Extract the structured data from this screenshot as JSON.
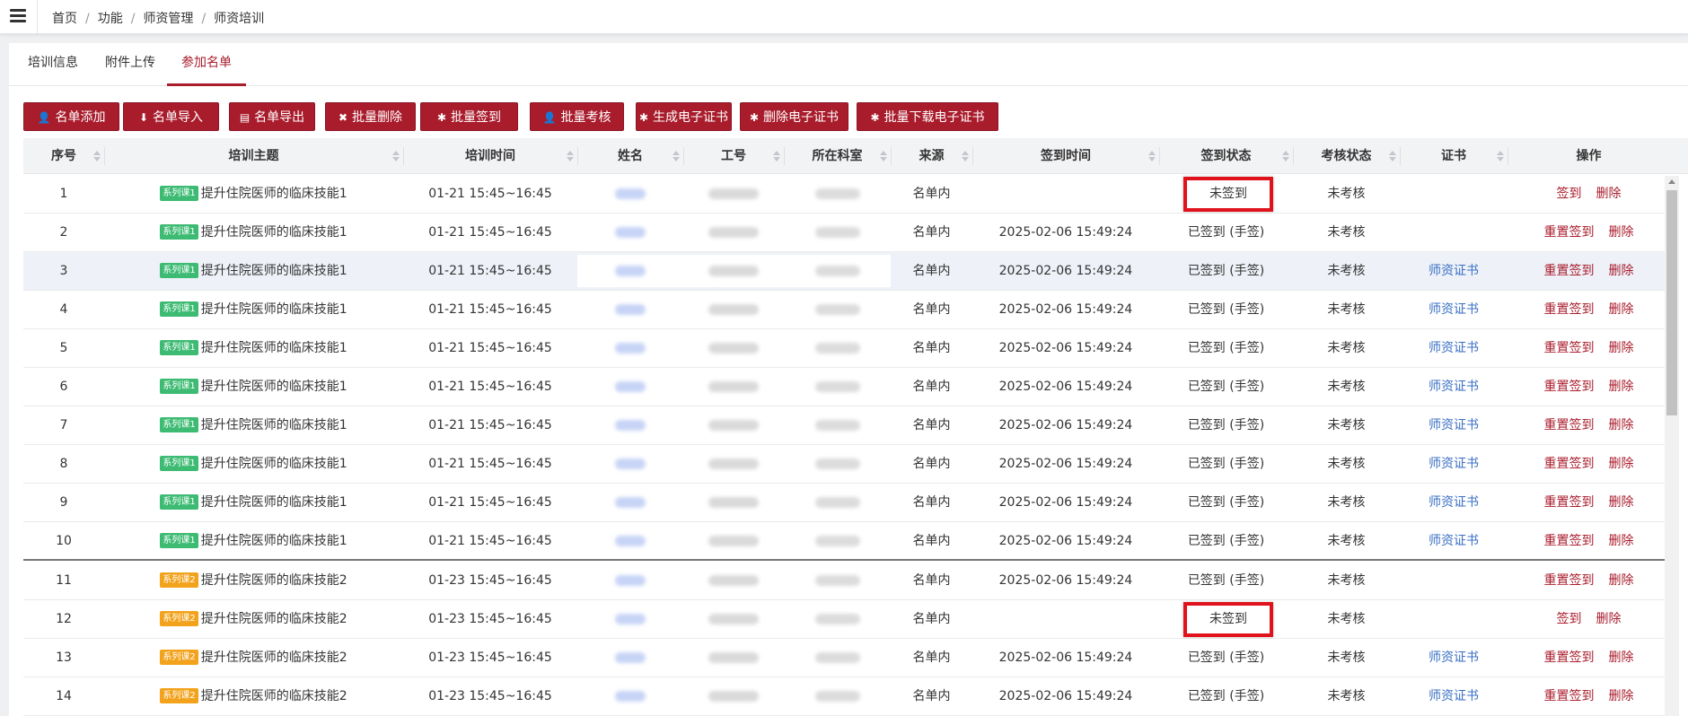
{
  "breadcrumb": [
    "首页",
    "功能",
    "师资管理",
    "师资培训"
  ],
  "tabs": [
    "培训信息",
    "附件上传",
    "参加名单"
  ],
  "active_tab": 2,
  "toolbar": [
    {
      "label": "名单添加",
      "icon": "user-plus-icon",
      "glyph": "👤"
    },
    {
      "label": "名单导入",
      "icon": "download-icon",
      "glyph": "⬇"
    },
    {
      "label": "名单导出",
      "icon": "file-export-icon",
      "glyph": "▤"
    },
    {
      "label": "批量删除",
      "icon": "close-icon",
      "glyph": "✖"
    },
    {
      "label": "批量签到",
      "icon": "gear-icon",
      "glyph": "✱"
    },
    {
      "label": "批量考核",
      "icon": "user-icon",
      "glyph": "👤"
    },
    {
      "label": "生成电子证书",
      "icon": "gear-icon",
      "glyph": "✱"
    },
    {
      "label": "删除电子证书",
      "icon": "gear-icon",
      "glyph": "✱"
    },
    {
      "label": "批量下载电子证书",
      "icon": "gear-icon",
      "glyph": "✱"
    }
  ],
  "columns": [
    "序号",
    "培训主题",
    "培训时间",
    "姓名",
    "工号",
    "所在科室",
    "来源",
    "签到时间",
    "签到状态",
    "考核状态",
    "证书",
    "操作"
  ],
  "rows": [
    {
      "no": "1",
      "tag": "系列课1",
      "tag_color": "#3dbb73",
      "topic": "提升住院医师的临床技能1",
      "time": "01-21 15:45~16:45",
      "source": "名单内",
      "sign_time": "",
      "sign_status": "未签到",
      "exam_status": "未考核",
      "cert": "",
      "actions": [
        "签到",
        "删除"
      ],
      "highlight_box": true
    },
    {
      "no": "2",
      "tag": "系列课1",
      "tag_color": "#3dbb73",
      "topic": "提升住院医师的临床技能1",
      "time": "01-21 15:45~16:45",
      "source": "名单内",
      "sign_time": "2025-02-06 15:49:24",
      "sign_status": "已签到 (手签)",
      "exam_status": "未考核",
      "cert": "",
      "actions": [
        "重置签到",
        "删除"
      ]
    },
    {
      "no": "3",
      "tag": "系列课1",
      "tag_color": "#3dbb73",
      "topic": "提升住院医师的临床技能1",
      "time": "01-21 15:45~16:45",
      "source": "名单内",
      "sign_time": "2025-02-06 15:49:24",
      "sign_status": "已签到 (手签)",
      "exam_status": "未考核",
      "cert": "师资证书",
      "actions": [
        "重置签到",
        "删除"
      ],
      "hover": true
    },
    {
      "no": "4",
      "tag": "系列课1",
      "tag_color": "#3dbb73",
      "topic": "提升住院医师的临床技能1",
      "time": "01-21 15:45~16:45",
      "source": "名单内",
      "sign_time": "2025-02-06 15:49:24",
      "sign_status": "已签到 (手签)",
      "exam_status": "未考核",
      "cert": "师资证书",
      "actions": [
        "重置签到",
        "删除"
      ]
    },
    {
      "no": "5",
      "tag": "系列课1",
      "tag_color": "#3dbb73",
      "topic": "提升住院医师的临床技能1",
      "time": "01-21 15:45~16:45",
      "source": "名单内",
      "sign_time": "2025-02-06 15:49:24",
      "sign_status": "已签到 (手签)",
      "exam_status": "未考核",
      "cert": "师资证书",
      "actions": [
        "重置签到",
        "删除"
      ]
    },
    {
      "no": "6",
      "tag": "系列课1",
      "tag_color": "#3dbb73",
      "topic": "提升住院医师的临床技能1",
      "time": "01-21 15:45~16:45",
      "source": "名单内",
      "sign_time": "2025-02-06 15:49:24",
      "sign_status": "已签到 (手签)",
      "exam_status": "未考核",
      "cert": "师资证书",
      "actions": [
        "重置签到",
        "删除"
      ]
    },
    {
      "no": "7",
      "tag": "系列课1",
      "tag_color": "#3dbb73",
      "topic": "提升住院医师的临床技能1",
      "time": "01-21 15:45~16:45",
      "source": "名单内",
      "sign_time": "2025-02-06 15:49:24",
      "sign_status": "已签到 (手签)",
      "exam_status": "未考核",
      "cert": "师资证书",
      "actions": [
        "重置签到",
        "删除"
      ]
    },
    {
      "no": "8",
      "tag": "系列课1",
      "tag_color": "#3dbb73",
      "topic": "提升住院医师的临床技能1",
      "time": "01-21 15:45~16:45",
      "source": "名单内",
      "sign_time": "2025-02-06 15:49:24",
      "sign_status": "已签到 (手签)",
      "exam_status": "未考核",
      "cert": "师资证书",
      "actions": [
        "重置签到",
        "删除"
      ]
    },
    {
      "no": "9",
      "tag": "系列课1",
      "tag_color": "#3dbb73",
      "topic": "提升住院医师的临床技能1",
      "time": "01-21 15:45~16:45",
      "source": "名单内",
      "sign_time": "2025-02-06 15:49:24",
      "sign_status": "已签到 (手签)",
      "exam_status": "未考核",
      "cert": "师资证书",
      "actions": [
        "重置签到",
        "删除"
      ]
    },
    {
      "no": "10",
      "tag": "系列课1",
      "tag_color": "#3dbb73",
      "topic": "提升住院医师的临床技能1",
      "time": "01-21 15:45~16:45",
      "source": "名单内",
      "sign_time": "2025-02-06 15:49:24",
      "sign_status": "已签到 (手签)",
      "exam_status": "未考核",
      "cert": "师资证书",
      "actions": [
        "重置签到",
        "删除"
      ],
      "group_end": true
    },
    {
      "no": "11",
      "tag": "系列课2",
      "tag_color": "#f2a21b",
      "topic": "提升住院医师的临床技能2",
      "time": "01-23 15:45~16:45",
      "source": "名单内",
      "sign_time": "2025-02-06 15:49:24",
      "sign_status": "已签到 (手签)",
      "exam_status": "未考核",
      "cert": "",
      "actions": [
        "重置签到",
        "删除"
      ]
    },
    {
      "no": "12",
      "tag": "系列课2",
      "tag_color": "#f2a21b",
      "topic": "提升住院医师的临床技能2",
      "time": "01-23 15:45~16:45",
      "source": "名单内",
      "sign_time": "",
      "sign_status": "未签到",
      "exam_status": "未考核",
      "cert": "",
      "actions": [
        "签到",
        "删除"
      ],
      "highlight_box": true
    },
    {
      "no": "13",
      "tag": "系列课2",
      "tag_color": "#f2a21b",
      "topic": "提升住院医师的临床技能2",
      "time": "01-23 15:45~16:45",
      "source": "名单内",
      "sign_time": "2025-02-06 15:49:24",
      "sign_status": "已签到 (手签)",
      "exam_status": "未考核",
      "cert": "师资证书",
      "actions": [
        "重置签到",
        "删除"
      ]
    },
    {
      "no": "14",
      "tag": "系列课2",
      "tag_color": "#f2a21b",
      "topic": "提升住院医师的临床技能2",
      "time": "01-23 15:45~16:45",
      "source": "名单内",
      "sign_time": "2025-02-06 15:49:24",
      "sign_status": "已签到 (手签)",
      "exam_status": "未考核",
      "cert": "师资证书",
      "actions": [
        "重置签到",
        "删除"
      ]
    }
  ]
}
